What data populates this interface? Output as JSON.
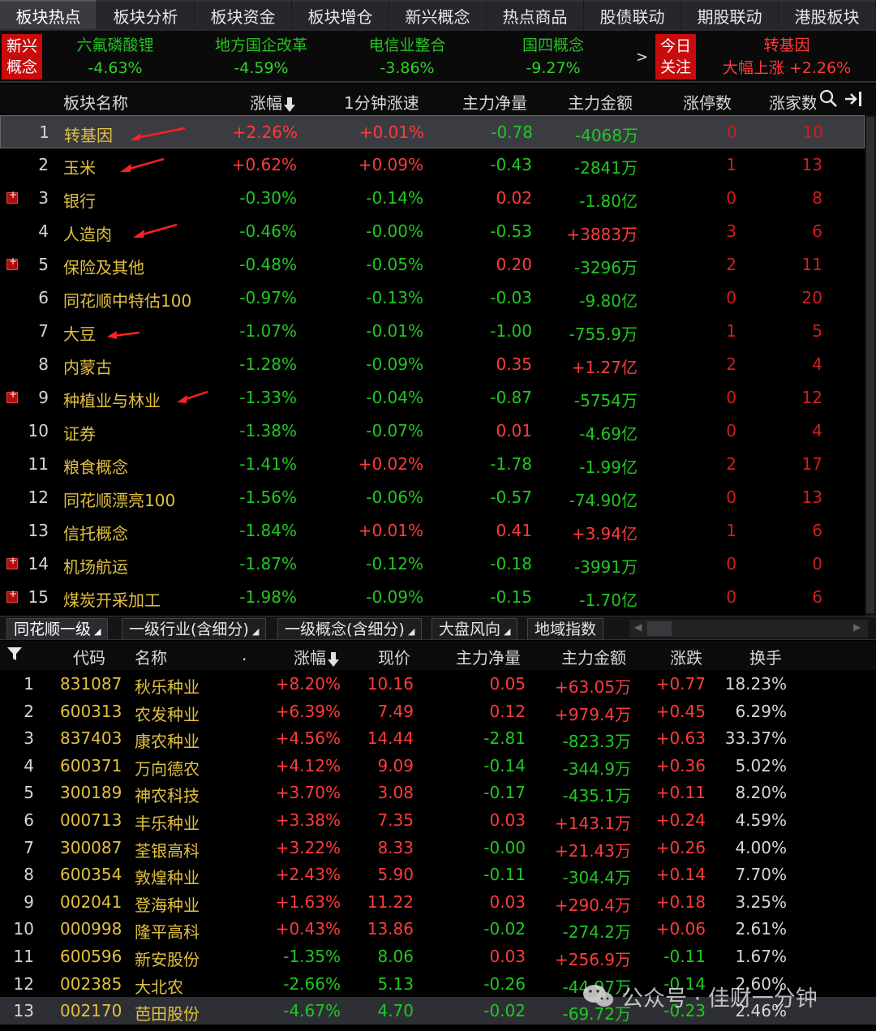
{
  "tabs": [
    "板块热点",
    "板块分析",
    "板块资金",
    "板块增仓",
    "新兴概念",
    "热点商品",
    "股债联动",
    "期股联动",
    "港股板块"
  ],
  "ticker": {
    "badge_left": [
      "新兴",
      "概念"
    ],
    "items": [
      {
        "name": "六氟磷酸锂",
        "value": "-4.63%"
      },
      {
        "name": "地方国企改革",
        "value": "-4.59%"
      },
      {
        "name": "电信业整合",
        "value": "-3.86%"
      },
      {
        "name": "国四概念",
        "value": "-9.27%"
      }
    ],
    "arrow": ">",
    "badge_right": [
      "今日",
      "关注"
    ],
    "hot_name": "转基因",
    "hot_text": "大幅上涨 +2.26%"
  },
  "sector_table": {
    "headers": {
      "name": "板块名称",
      "change": "涨幅",
      "speed": "1分钟涨速",
      "net": "主力净量",
      "amount": "主力金额",
      "limit_up": "涨停数",
      "rise_count": "涨家数"
    },
    "rows": [
      {
        "idx": "1",
        "name": "转基因",
        "change": "+2.26%",
        "speed": "+0.01%",
        "net": "-0.78",
        "amount": "-4068万",
        "limit_up": "0",
        "rise": "10"
      },
      {
        "idx": "2",
        "name": "玉米",
        "change": "+0.62%",
        "speed": "+0.09%",
        "net": "-0.43",
        "amount": "-2841万",
        "limit_up": "1",
        "rise": "13"
      },
      {
        "idx": "3",
        "name": "银行",
        "change": "-0.30%",
        "speed": "-0.14%",
        "net": "0.02",
        "amount": "-1.80亿",
        "limit_up": "0",
        "rise": "8"
      },
      {
        "idx": "4",
        "name": "人造肉",
        "change": "-0.46%",
        "speed": "-0.00%",
        "net": "-0.53",
        "amount": "+3883万",
        "limit_up": "3",
        "rise": "6"
      },
      {
        "idx": "5",
        "name": "保险及其他",
        "change": "-0.48%",
        "speed": "-0.05%",
        "net": "0.20",
        "amount": "-3296万",
        "limit_up": "2",
        "rise": "11"
      },
      {
        "idx": "6",
        "name": "同花顺中特估100",
        "change": "-0.97%",
        "speed": "-0.13%",
        "net": "-0.03",
        "amount": "-9.80亿",
        "limit_up": "0",
        "rise": "20"
      },
      {
        "idx": "7",
        "name": "大豆",
        "change": "-1.07%",
        "speed": "-0.01%",
        "net": "-1.00",
        "amount": "-755.9万",
        "limit_up": "1",
        "rise": "5"
      },
      {
        "idx": "8",
        "name": "内蒙古",
        "change": "-1.28%",
        "speed": "-0.09%",
        "net": "0.35",
        "amount": "+1.27亿",
        "limit_up": "2",
        "rise": "4"
      },
      {
        "idx": "9",
        "name": "种植业与林业",
        "change": "-1.33%",
        "speed": "-0.04%",
        "net": "-0.87",
        "amount": "-5754万",
        "limit_up": "0",
        "rise": "12"
      },
      {
        "idx": "10",
        "name": "证券",
        "change": "-1.38%",
        "speed": "-0.07%",
        "net": "0.01",
        "amount": "-4.69亿",
        "limit_up": "0",
        "rise": "4"
      },
      {
        "idx": "11",
        "name": "粮食概念",
        "change": "-1.41%",
        "speed": "+0.02%",
        "net": "-1.78",
        "amount": "-1.99亿",
        "limit_up": "2",
        "rise": "17"
      },
      {
        "idx": "12",
        "name": "同花顺漂亮100",
        "change": "-1.56%",
        "speed": "-0.06%",
        "net": "-0.57",
        "amount": "-74.90亿",
        "limit_up": "0",
        "rise": "13"
      },
      {
        "idx": "13",
        "name": "信托概念",
        "change": "-1.84%",
        "speed": "+0.01%",
        "net": "0.41",
        "amount": "+3.94亿",
        "limit_up": "1",
        "rise": "6"
      },
      {
        "idx": "14",
        "name": "机场航运",
        "change": "-1.87%",
        "speed": "-0.12%",
        "net": "-0.18",
        "amount": "-3991万",
        "limit_up": "0",
        "rise": "0"
      },
      {
        "idx": "15",
        "name": "煤炭开采加工",
        "change": "-1.98%",
        "speed": "-0.09%",
        "net": "-0.15",
        "amount": "-1.70亿",
        "limit_up": "0",
        "rise": "6"
      }
    ]
  },
  "sub_tabs": [
    "同花顺一级",
    "一级行业(含细分)",
    "一级概念(含细分)",
    "大盘风向",
    "地域指数"
  ],
  "stock_table": {
    "headers": {
      "code": "代码",
      "name": "名称",
      "dot": ".",
      "change": "涨幅",
      "price": "现价",
      "net": "主力净量",
      "amount": "主力金额",
      "diff": "涨跌",
      "turnover": "换手"
    },
    "rows": [
      {
        "idx": "1",
        "code": "831087",
        "name": "秋乐种业",
        "change": "+8.20%",
        "price": "10.16",
        "net": "0.05",
        "amount": "+63.05万",
        "diff": "+0.77",
        "turnover": "18.23%"
      },
      {
        "idx": "2",
        "code": "600313",
        "name": "农发种业",
        "change": "+6.39%",
        "price": "7.49",
        "net": "0.12",
        "amount": "+979.4万",
        "diff": "+0.45",
        "turnover": "6.29%"
      },
      {
        "idx": "3",
        "code": "837403",
        "name": "康农种业",
        "change": "+4.56%",
        "price": "14.44",
        "net": "-2.81",
        "amount": "-823.3万",
        "diff": "+0.63",
        "turnover": "33.37%"
      },
      {
        "idx": "4",
        "code": "600371",
        "name": "万向德农",
        "change": "+4.12%",
        "price": "9.09",
        "net": "-0.14",
        "amount": "-344.9万",
        "diff": "+0.36",
        "turnover": "5.02%"
      },
      {
        "idx": "5",
        "code": "300189",
        "name": "神农科技",
        "change": "+3.70%",
        "price": "3.08",
        "net": "-0.17",
        "amount": "-435.1万",
        "diff": "+0.11",
        "turnover": "8.20%"
      },
      {
        "idx": "6",
        "code": "000713",
        "name": "丰乐种业",
        "change": "+3.38%",
        "price": "7.35",
        "net": "0.03",
        "amount": "+143.1万",
        "diff": "+0.24",
        "turnover": "4.59%"
      },
      {
        "idx": "7",
        "code": "300087",
        "name": "荃银高科",
        "change": "+3.22%",
        "price": "8.33",
        "net": "-0.00",
        "amount": "+21.43万",
        "diff": "+0.26",
        "turnover": "4.00%"
      },
      {
        "idx": "8",
        "code": "600354",
        "name": "敦煌种业",
        "change": "+2.43%",
        "price": "5.90",
        "net": "-0.11",
        "amount": "-304.4万",
        "diff": "+0.14",
        "turnover": "7.70%"
      },
      {
        "idx": "9",
        "code": "002041",
        "name": "登海种业",
        "change": "+1.63%",
        "price": "11.22",
        "net": "0.03",
        "amount": "+290.4万",
        "diff": "+0.18",
        "turnover": "3.25%"
      },
      {
        "idx": "10",
        "code": "000998",
        "name": "隆平高科",
        "change": "+0.43%",
        "price": "13.86",
        "net": "-0.02",
        "amount": "-274.2万",
        "diff": "+0.06",
        "turnover": "2.61%"
      },
      {
        "idx": "11",
        "code": "600596",
        "name": "新安股份",
        "change": "-1.35%",
        "price": "8.06",
        "net": "0.03",
        "amount": "+256.9万",
        "diff": "-0.11",
        "turnover": "1.67%"
      },
      {
        "idx": "12",
        "code": "002385",
        "name": "大北农",
        "change": "-2.66%",
        "price": "5.13",
        "net": "-0.26",
        "amount": "-44.97万",
        "diff": "-0.14",
        "turnover": "2.60%"
      },
      {
        "idx": "13",
        "code": "002170",
        "name": "芭田股份",
        "change": "-4.67%",
        "price": "4.70",
        "net": "-0.02",
        "amount": "-69.72万",
        "diff": "-0.23",
        "turnover": "2.46%"
      }
    ]
  },
  "watermark": "公众号 · 佳财一分钟",
  "icons": {
    "sort": "arrow-down-icon",
    "search": "search-icon",
    "collapse": "collapse-right-icon",
    "filter": "filter-icon",
    "plus": "plus-square-icon",
    "annotation": "red-arrow-icon",
    "wechat": "wechat-icon"
  },
  "colors": {
    "up": "#ff3b3b",
    "down": "#21c721",
    "name": "#e0c040",
    "badge": "#c80b0b"
  }
}
